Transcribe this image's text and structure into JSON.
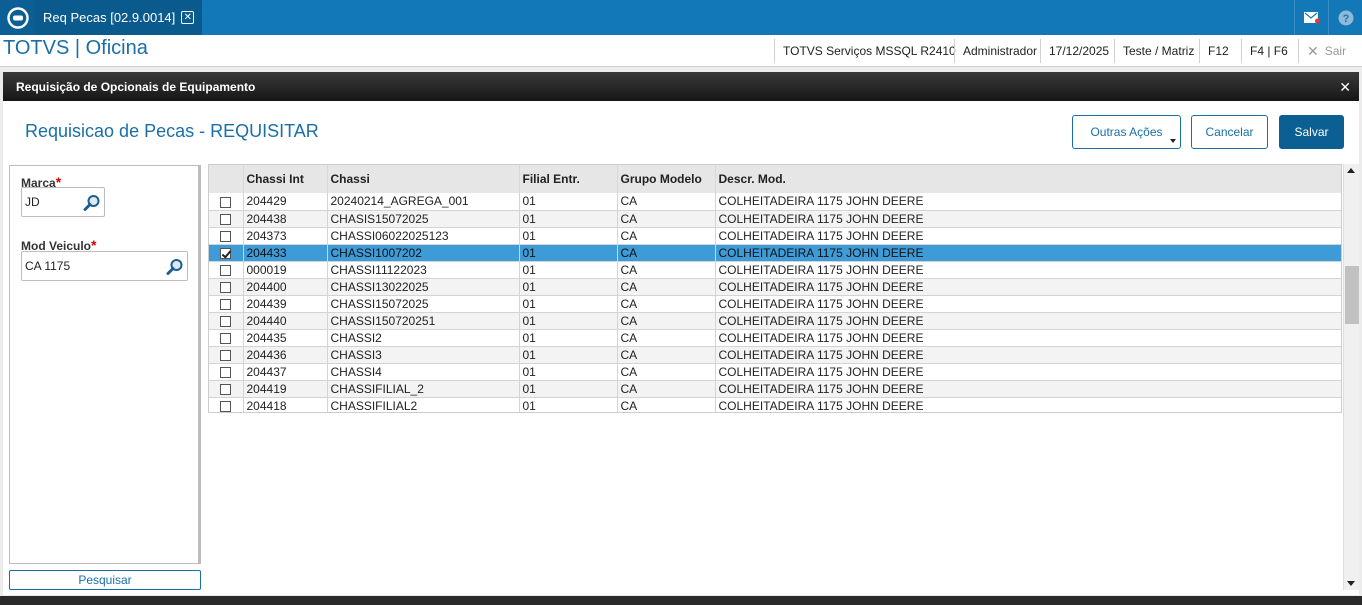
{
  "topbar": {
    "tab_label": "Req Pecas [02.9.0014]"
  },
  "header": {
    "brand": "TOTVS | Oficina",
    "environment": "TOTVS Serviços MSSQL R2410",
    "user": "Administrador",
    "date": "17/12/2025",
    "branch": "Teste / Matriz",
    "f12": "F12",
    "f4f6": "F4 | F6",
    "sair": "Sair"
  },
  "dialog": {
    "title": "Requisição de Opcionais de Equipamento",
    "form_title": "Requisicao de Pecas - REQUISITAR",
    "buttons": {
      "outras_acoes": "Outras Ações",
      "cancelar": "Cancelar",
      "salvar": "Salvar"
    }
  },
  "filters": {
    "marca_label": "Marca",
    "marca_value": "JD",
    "mod_label": "Mod Veiculo",
    "mod_value": "CA 1175",
    "pesquisar": "Pesquisar"
  },
  "grid": {
    "columns": [
      "Chassi Int",
      "Chassi",
      "Filial Entr.",
      "Grupo Modelo",
      "Descr. Mod."
    ],
    "rows": [
      {
        "checked": false,
        "cells": [
          "204429",
          "20240214_AGREGA_001",
          "01",
          "CA",
          "COLHEITADEIRA 1175 JOHN DEERE"
        ]
      },
      {
        "checked": false,
        "cells": [
          "204438",
          "CHASIS15072025",
          "01",
          "CA",
          "COLHEITADEIRA 1175 JOHN DEERE"
        ]
      },
      {
        "checked": false,
        "cells": [
          "204373",
          "CHASSI06022025123",
          "01",
          "CA",
          "COLHEITADEIRA 1175 JOHN DEERE"
        ]
      },
      {
        "checked": true,
        "cells": [
          "204433",
          "CHASSI1007202",
          "01",
          "CA",
          "COLHEITADEIRA 1175 JOHN DEERE"
        ]
      },
      {
        "checked": false,
        "cells": [
          "000019",
          "CHASSI11122023",
          "01",
          "CA",
          "COLHEITADEIRA 1175 JOHN DEERE"
        ]
      },
      {
        "checked": false,
        "cells": [
          "204400",
          "CHASSI13022025",
          "01",
          "CA",
          "COLHEITADEIRA 1175 JOHN DEERE"
        ]
      },
      {
        "checked": false,
        "cells": [
          "204439",
          "CHASSI15072025",
          "01",
          "CA",
          "COLHEITADEIRA 1175 JOHN DEERE"
        ]
      },
      {
        "checked": false,
        "cells": [
          "204440",
          "CHASSI150720251",
          "01",
          "CA",
          "COLHEITADEIRA 1175 JOHN DEERE"
        ]
      },
      {
        "checked": false,
        "cells": [
          "204435",
          "CHASSI2",
          "01",
          "CA",
          "COLHEITADEIRA 1175 JOHN DEERE"
        ]
      },
      {
        "checked": false,
        "cells": [
          "204436",
          "CHASSI3",
          "01",
          "CA",
          "COLHEITADEIRA 1175 JOHN DEERE"
        ]
      },
      {
        "checked": false,
        "cells": [
          "204437",
          "CHASSI4",
          "01",
          "CA",
          "COLHEITADEIRA 1175 JOHN DEERE"
        ]
      },
      {
        "checked": false,
        "cells": [
          "204419",
          "CHASSIFILIAL_2",
          "01",
          "CA",
          "COLHEITADEIRA 1175 JOHN DEERE"
        ]
      },
      {
        "checked": false,
        "cells": [
          "204418",
          "CHASSIFILIAL2",
          "01",
          "CA",
          "COLHEITADEIRA 1175 JOHN DEERE"
        ]
      }
    ],
    "selected_row": 3
  },
  "colors": {
    "brand_blue": "#1278b8",
    "selected_row": "#3d9bd8",
    "primary_button": "#0c5f93",
    "required_mark": "#d50000"
  },
  "icons": {
    "app": "totvs-logo-icon",
    "tab_close": "close-icon",
    "messages": "mail-icon",
    "help": "help-icon",
    "lookup": "search-icon",
    "sair": "close-icon"
  }
}
